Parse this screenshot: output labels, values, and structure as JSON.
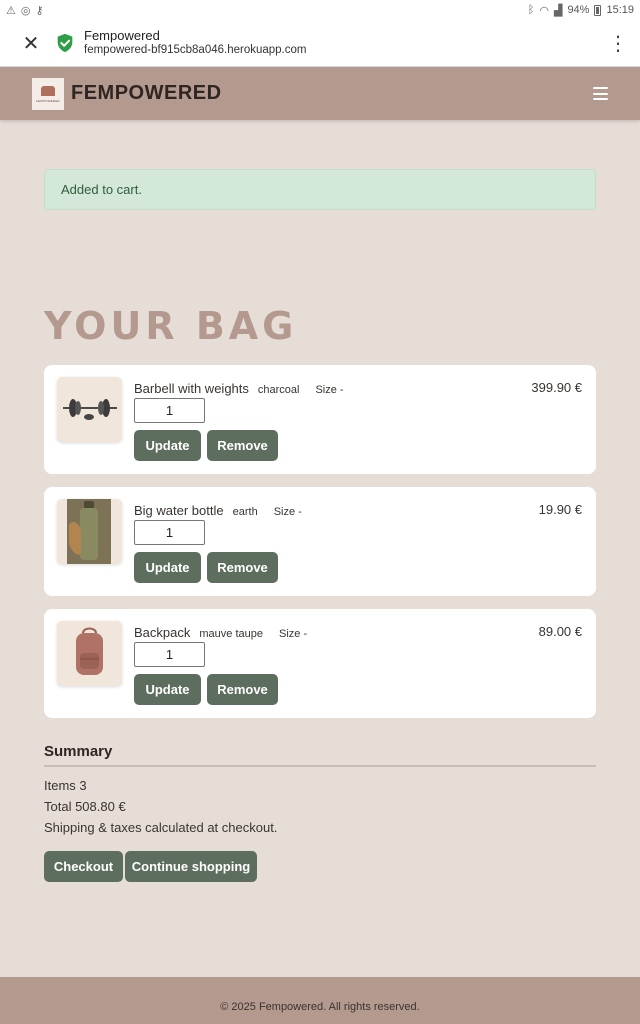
{
  "status_bar": {
    "time": "15:19",
    "battery": "94%"
  },
  "browser": {
    "site_title": "Fempowered",
    "url": "fempowered-bf915cb8a046.herokuapp.com"
  },
  "header": {
    "brand": "FEMPOWERED",
    "logo_text": "FEMPOWERED"
  },
  "alert": {
    "message": "Added to cart."
  },
  "page": {
    "title": "YOUR BAG"
  },
  "cart": {
    "items": [
      {
        "name": "Barbell with weights",
        "color": "charcoal",
        "size": "Size -",
        "quantity": "1",
        "price": "399.90 €",
        "update_label": "Update",
        "remove_label": "Remove"
      },
      {
        "name": "Big water bottle",
        "color": "earth",
        "size": "Size -",
        "quantity": "1",
        "price": "19.90 €",
        "update_label": "Update",
        "remove_label": "Remove"
      },
      {
        "name": "Backpack",
        "color": "mauve taupe",
        "size": "Size -",
        "quantity": "1",
        "price": "89.00 €",
        "update_label": "Update",
        "remove_label": "Remove"
      }
    ]
  },
  "summary": {
    "title": "Summary",
    "items": "Items 3",
    "total": "Total 508.80 €",
    "note": "Shipping & taxes calculated at checkout.",
    "checkout_label": "Checkout",
    "continue_label": "Continue shopping"
  },
  "footer": {
    "text": "© 2025 Fempowered. All rights reserved."
  },
  "colors": {
    "header_bg": "#b49a8e",
    "page_bg": "#e5ddd6",
    "button_bg": "#5e6e5e",
    "alert_bg": "#d4e8d9"
  }
}
